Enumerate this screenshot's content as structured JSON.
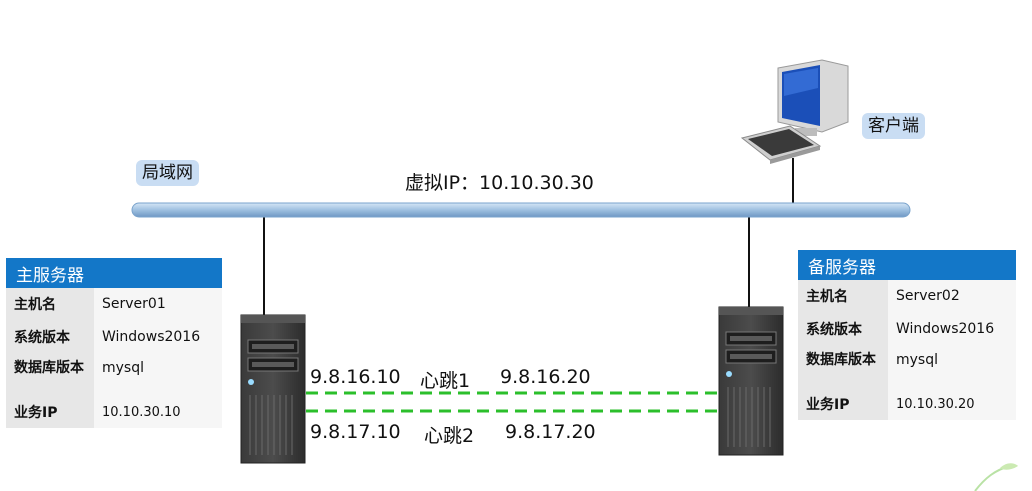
{
  "bubbles": {
    "lan": "局域网",
    "client": "客户端"
  },
  "vip_label": "虚拟IP：10.10.30.30",
  "primary": {
    "title": "主服务器",
    "rows": [
      {
        "k": "主机名",
        "v": "Server01"
      },
      {
        "k": "系统版本",
        "v": "Windows2016"
      },
      {
        "k": "数据库版本",
        "v": "mysql"
      },
      {
        "k": "业务IP",
        "v": "10.10.30.10"
      }
    ]
  },
  "backup": {
    "title": "备服务器",
    "rows": [
      {
        "k": "主机名",
        "v": "Server02"
      },
      {
        "k": "系统版本",
        "v": "Windows2016"
      },
      {
        "k": "数据库版本",
        "v": "mysql"
      },
      {
        "k": "业务IP",
        "v": "10.10.30.20"
      }
    ]
  },
  "heartbeats": [
    {
      "left_ip": "9.8.16.10",
      "label": "心跳1",
      "right_ip": "9.8.16.20"
    },
    {
      "left_ip": "9.8.17.10",
      "label": "心跳2",
      "right_ip": "9.8.17.20"
    }
  ],
  "colors": {
    "network_bar": "#9ec0e0",
    "heartbeat": "#2bbf2b",
    "table_header": "#1377c8"
  },
  "icons": [
    "desktop-computer-icon",
    "tower-server-icon",
    "tower-server-icon"
  ]
}
